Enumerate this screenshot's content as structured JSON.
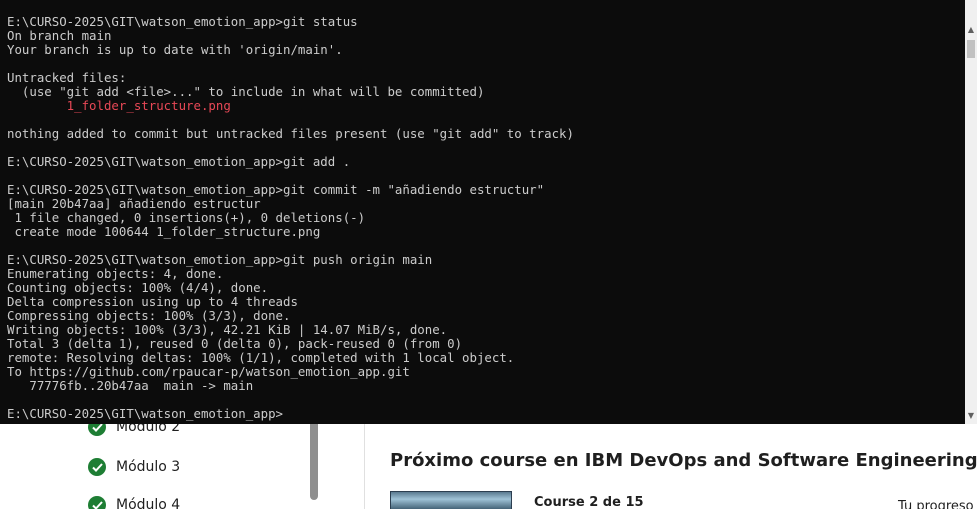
{
  "console": {
    "lines": [
      {
        "text": "E:\\CURSO-2025\\GIT\\watson_emotion_app>git status",
        "color": "default"
      },
      {
        "text": "On branch main",
        "color": "default"
      },
      {
        "text": "Your branch is up to date with 'origin/main'.",
        "color": "default"
      },
      {
        "text": "",
        "color": "default"
      },
      {
        "text": "Untracked files:",
        "color": "default"
      },
      {
        "text": "  (use \"git add <file>...\" to include in what will be committed)",
        "color": "default"
      },
      {
        "text": "        1_folder_structure.png",
        "color": "red"
      },
      {
        "text": "",
        "color": "default"
      },
      {
        "text": "nothing added to commit but untracked files present (use \"git add\" to track)",
        "color": "default"
      },
      {
        "text": "",
        "color": "default"
      },
      {
        "text": "E:\\CURSO-2025\\GIT\\watson_emotion_app>git add .",
        "color": "default"
      },
      {
        "text": "",
        "color": "default"
      },
      {
        "text": "E:\\CURSO-2025\\GIT\\watson_emotion_app>git commit -m \"añadiendo estructur\"",
        "color": "default"
      },
      {
        "text": "[main 20b47aa] añadiendo estructur",
        "color": "default"
      },
      {
        "text": " 1 file changed, 0 insertions(+), 0 deletions(-)",
        "color": "default"
      },
      {
        "text": " create mode 100644 1_folder_structure.png",
        "color": "default"
      },
      {
        "text": "",
        "color": "default"
      },
      {
        "text": "E:\\CURSO-2025\\GIT\\watson_emotion_app>git push origin main",
        "color": "default"
      },
      {
        "text": "Enumerating objects: 4, done.",
        "color": "default"
      },
      {
        "text": "Counting objects: 100% (4/4), done.",
        "color": "default"
      },
      {
        "text": "Delta compression using up to 4 threads",
        "color": "default"
      },
      {
        "text": "Compressing objects: 100% (3/3), done.",
        "color": "default"
      },
      {
        "text": "Writing objects: 100% (3/3), 42.21 KiB | 14.07 MiB/s, done.",
        "color": "default"
      },
      {
        "text": "Total 3 (delta 1), reused 0 (delta 0), pack-reused 0 (from 0)",
        "color": "default"
      },
      {
        "text": "remote: Resolving deltas: 100% (1/1), completed with 1 local object.",
        "color": "default"
      },
      {
        "text": "To https://github.com/rpaucar-p/watson_emotion_app.git",
        "color": "default"
      },
      {
        "text": "   77776fb..20b47aa  main -> main",
        "color": "default"
      },
      {
        "text": "",
        "color": "default"
      },
      {
        "text": "E:\\CURSO-2025\\GIT\\watson_emotion_app>",
        "color": "default"
      }
    ],
    "colors": {
      "background": "#0c0c0c",
      "text": "#cccccc",
      "untracked": "#e74856"
    },
    "icons": {
      "scroll_up": "triangle-up-icon",
      "scroll_down": "triangle-down-icon"
    }
  },
  "course_page": {
    "modules": [
      {
        "label": "Módulo 2",
        "icon": "check-circle-icon"
      },
      {
        "label": "Módulo 3",
        "icon": "check-circle-icon"
      },
      {
        "label": "Módulo 4",
        "icon": "check-circle-icon"
      }
    ],
    "next_course_heading": "Próximo course en IBM DevOps and Software Engineering",
    "course_counter": "Course 2 de 15",
    "progress_label": "Tu progreso",
    "colors": {
      "check": "#1e7e34",
      "text": "#1f1f1f"
    }
  }
}
